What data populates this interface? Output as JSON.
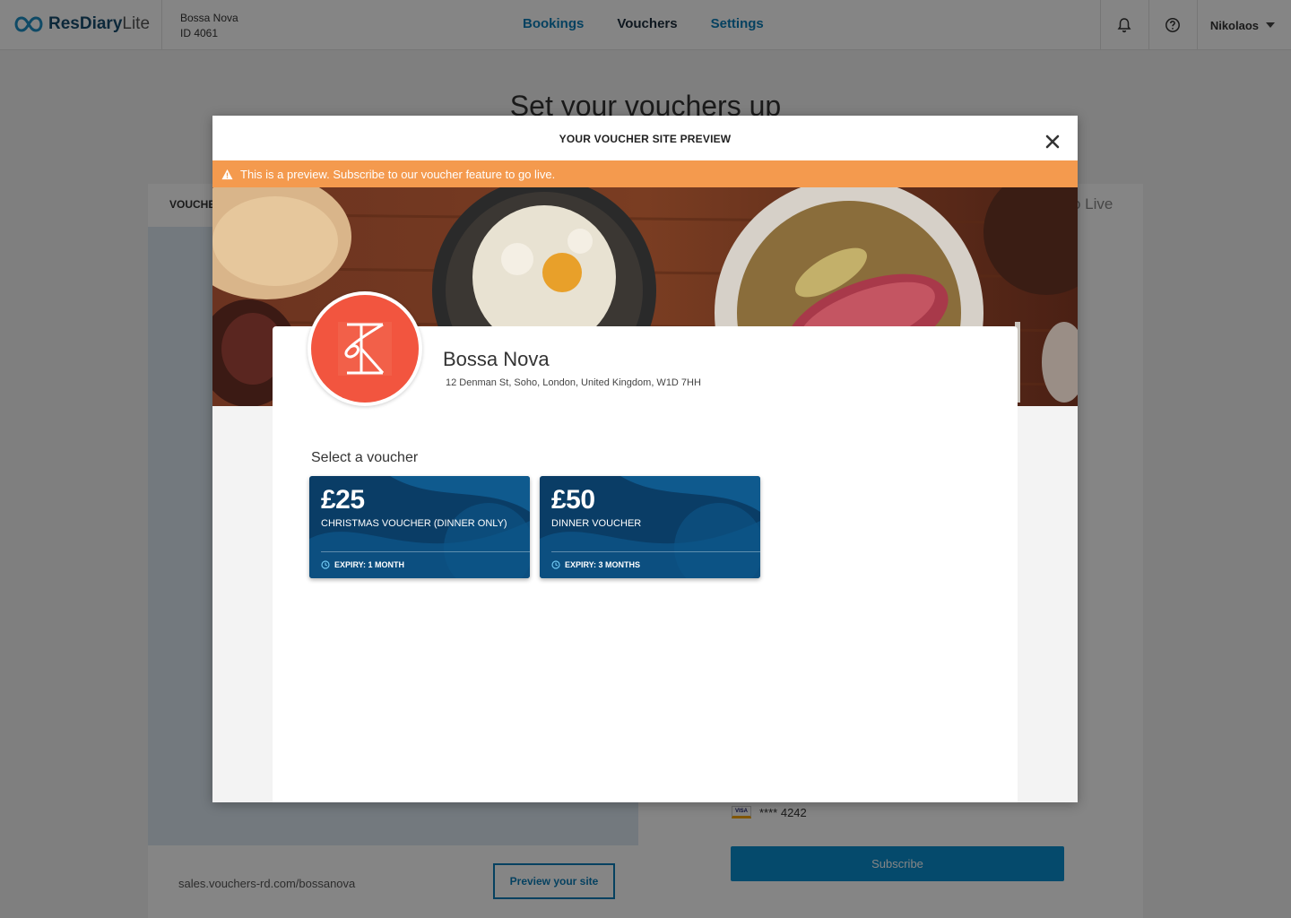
{
  "app": {
    "brand_name": "ResDiary",
    "brand_suffix": "Lite"
  },
  "venue": {
    "name": "Bossa Nova",
    "id_label": "ID 4061"
  },
  "nav": {
    "items": [
      {
        "label": "Bookings"
      },
      {
        "label": "Vouchers"
      },
      {
        "label": "Settings"
      }
    ],
    "active": "Vouchers"
  },
  "user": {
    "name": "Nikolaos"
  },
  "background_page": {
    "title": "Set your vouchers up",
    "tab_label": "VOUCHE",
    "go_live_label": "o Live",
    "site_url": "sales.vouchers-rd.com/bossanova",
    "preview_button": "Preview your site",
    "card_brand": "VISA",
    "card_masked": "**** 4242",
    "subscribe_button": "Subscribe"
  },
  "modal": {
    "title": "YOUR VOUCHER SITE PREVIEW",
    "alert_text": "This is a preview. Subscribe to our voucher feature to go live.",
    "venue_name": "Bossa Nova",
    "venue_address": "12 Denman St, Soho, London, United Kingdom, W1D 7HH",
    "logo_letter": "K",
    "select_label": "Select a voucher",
    "vouchers": [
      {
        "price": "£25",
        "name": "CHRISTMAS VOUCHER (DINNER ONLY)",
        "expiry": "EXPIRY: 1 MONTH"
      },
      {
        "price": "£50",
        "name": "DINNER VOUCHER",
        "expiry": "EXPIRY: 3 MONTHS"
      }
    ]
  },
  "colors": {
    "primary": "#0b7eb8",
    "alert": "#f49a4e",
    "voucher_bg": "#0a3d66",
    "logo_red": "#f2553f"
  }
}
